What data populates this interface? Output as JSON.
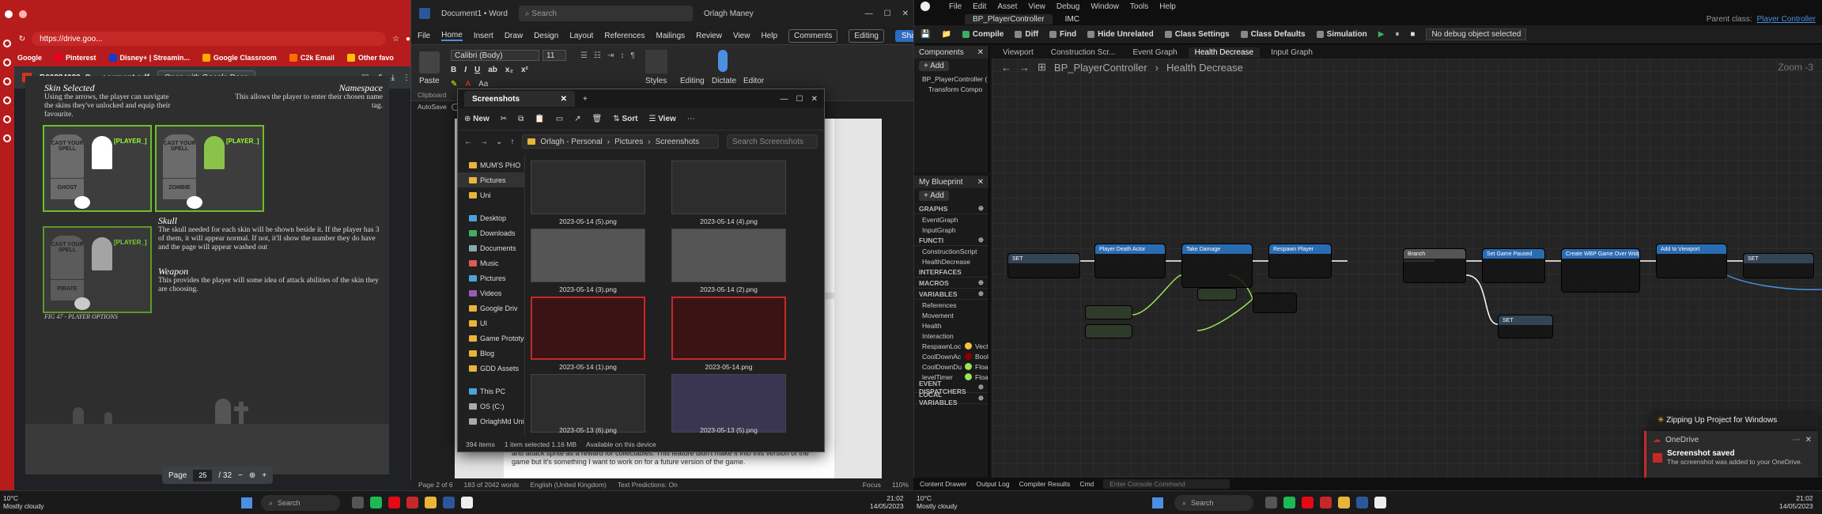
{
  "browser": {
    "url": "https://drive.goo...",
    "bookmarks": [
      "Google",
      "Pinterest",
      "Disney+ | Streamin...",
      "Google Classroom",
      "C2k Email",
      "Other favo"
    ],
    "file_name": "B00884033_O ... ocument.pdf",
    "open_with": "Open with Google Docs",
    "page_label": "Page",
    "page_current": "25",
    "page_total": "/ 32",
    "doc": {
      "skin_heading": "Skin Selected",
      "skin_text": "Using the arrows, the player can navigate the skins they've unlocked and equip their favourite.",
      "namespace_heading": "Namespace",
      "namespace_text": "This allows the player to enter their chosen name tag.",
      "skull_heading": "Skull",
      "skull_text": "The skull needed for each skin will be shown beside it. If the player has 3 of them, it will appear normal. If not, it'll show the number they do have and the page will appear washed out",
      "weapon_heading": "Weapon",
      "weapon_text": "This provides the player will some idea of attack abilities of the skin they are choosing.",
      "fig_caption": "FIG 47 - PLAYER OPTIONS",
      "player_label": "[PLAYER_]",
      "stone_label": "CAST YOUR SPELL",
      "skin_names": [
        "GHOST",
        "ZOMBIE",
        "PIRATE"
      ]
    }
  },
  "word": {
    "title": "Document1 • Word",
    "search": "Search",
    "user": "Orlagh Maney",
    "menu": [
      "File",
      "Home",
      "Insert",
      "Draw",
      "Design",
      "Layout",
      "References",
      "Mailings",
      "Review",
      "View",
      "Help"
    ],
    "comments": "Comments",
    "editing": "Editing",
    "share": "Share",
    "font": "Calibri (Body)",
    "size": "11",
    "groups": [
      "Paste",
      "Clipboard",
      "Styles",
      "Editing",
      "Dictate",
      "Editor"
    ],
    "autosave": "AutoSave",
    "doc_text": "and attack sprite as a reward for collectables. This feature didn't make it into this version of the game but it's something I want to work on for a future version of the game.",
    "status": [
      "Page 2 of 6",
      "183 of 2042 words",
      "English (United Kingdom)",
      "Text Predictions: On",
      "Focus",
      "110%"
    ]
  },
  "explorer": {
    "tab": "Screenshots",
    "cmd": [
      "New",
      "Sort",
      "View"
    ],
    "crumbs": [
      "Orlagh - Personal",
      "Pictures",
      "Screenshots"
    ],
    "search": "Search Screenshots",
    "tree": [
      "MUM'S PHO",
      "Pictures",
      "Uni",
      "Desktop",
      "Downloads",
      "Documents",
      "Music",
      "Pictures",
      "Videos",
      "Google Driv",
      "UI",
      "Game Prototy",
      "Blog",
      "GDD Assets",
      "This PC",
      "OS (C:)",
      "OrlaghMd Uni"
    ],
    "files": [
      "2023-05-14 (5).png",
      "2023-05-14 (4).png",
      "2023-05-14 (3).png",
      "2023-05-14 (2).png",
      "2023-05-14 (1).png",
      "2023-05-14.png",
      "2023-05-13 (6).png",
      "2023-05-13 (5).png"
    ],
    "status": [
      "394 items",
      "1 item selected 1.16 MB",
      "Available on this device"
    ]
  },
  "taskbar": {
    "weather_temp": "10°C",
    "weather_desc": "Mostly cloudy",
    "search": "Search",
    "time": "21:02",
    "date": "14/05/2023"
  },
  "unreal": {
    "menu": [
      "File",
      "Edit",
      "Asset",
      "View",
      "Debug",
      "Window",
      "Tools",
      "Help"
    ],
    "tabs": [
      "BP_PlayerController",
      "IMC"
    ],
    "parent_label": "Parent class:",
    "parent_value": "Player Controller",
    "toolbar": [
      "Compile",
      "Diff",
      "Find",
      "Hide Unrelated",
      "Class Settings",
      "Class Defaults",
      "Simulation"
    ],
    "debug": "No debug object selected",
    "components_title": "Components",
    "add": "+ Add",
    "components": [
      "BP_PlayerController (",
      "Transform Compo"
    ],
    "myblueprint_title": "My Blueprint",
    "sections": [
      "GRAPHS",
      "FUNCTI",
      "INTERFACES",
      "MACROS",
      "VARIABLES",
      "EVENT DISPATCHERS",
      "LOCAL VARIABLES"
    ],
    "graphs": [
      "EventGraph",
      "InputGraph"
    ],
    "functions": [
      "ConstructionScript",
      "HealthDecrease"
    ],
    "var_groups": [
      "References",
      "Movement",
      "Health",
      "Interaction"
    ],
    "variables": [
      {
        "name": "RespawnLoc",
        "type": "Vect"
      },
      {
        "name": "CoolDownAc",
        "type": "Bool"
      },
      {
        "name": "CoolDownDu",
        "type": "Floa"
      },
      {
        "name": "levelTimer",
        "type": "Floa"
      }
    ],
    "graph_tabs": [
      "Viewport",
      "Construction Scr...",
      "Event Graph",
      "Health Decrease",
      "Input Graph"
    ],
    "breadcrumb_bp": "BP_PlayerController",
    "breadcrumb_fn": "Health Decrease",
    "zoom": "Zoom -3",
    "nodes": [
      "SET",
      "Player Death Actor",
      "Take Damage",
      "Respawn Player",
      "Branch",
      "Set Game Paused",
      "Create WBP Game Over Widget",
      "Add to Viewport",
      "SET",
      "SET"
    ],
    "zipping": "Zipping Up Project for Windows",
    "onedrive_title": "OneDrive",
    "toast_title": "Screenshot saved",
    "toast_body": "The screenshot was added to your OneDrive.",
    "bottom": [
      "Content Drawer",
      "Output Log",
      "Cmd",
      "Enter Console Command"
    ],
    "compile_results": "Compiler Results"
  }
}
